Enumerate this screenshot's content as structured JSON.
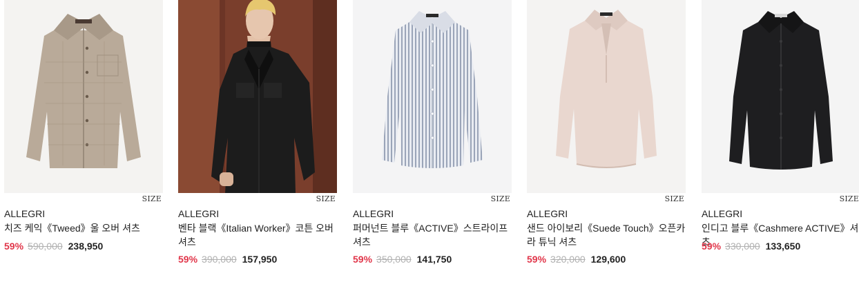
{
  "products": [
    {
      "image": "tweed-shirt-jacket-image",
      "size_label": "SIZE",
      "brand": "ALLEGRI",
      "name": "치즈 케익《Tweed》울 오버 셔츠",
      "discount": "59%",
      "original_price": "590,000",
      "sale_price": "238,950"
    },
    {
      "image": "model-black-worker-shirt-image",
      "size_label": "SIZE",
      "brand": "ALLEGRI",
      "name": "벤타 블랙《Italian Worker》코튼 오버 셔츠",
      "discount": "59%",
      "original_price": "390,000",
      "sale_price": "157,950"
    },
    {
      "image": "stripe-shirt-image",
      "size_label": "SIZE",
      "brand": "ALLEGRI",
      "name": "퍼머넌트 블루《ACTIVE》스트라이프 셔츠",
      "discount": "59%",
      "original_price": "350,000",
      "sale_price": "141,750"
    },
    {
      "image": "open-collar-tunic-shirt-image",
      "size_label": "SIZE",
      "brand": "ALLEGRI",
      "name": "샌드 아이보리《Suede Touch》오픈카라 튜닉 셔츠",
      "discount": "59%",
      "original_price": "320,000",
      "sale_price": "129,600"
    },
    {
      "image": "black-cashmere-shirt-image",
      "size_label": "SIZE",
      "brand": "ALLEGRI",
      "name": "인디고 블루《Cashmere ACTIVE》셔츠",
      "discount": "59%",
      "original_price": "330,000",
      "sale_price": "133,650"
    }
  ]
}
